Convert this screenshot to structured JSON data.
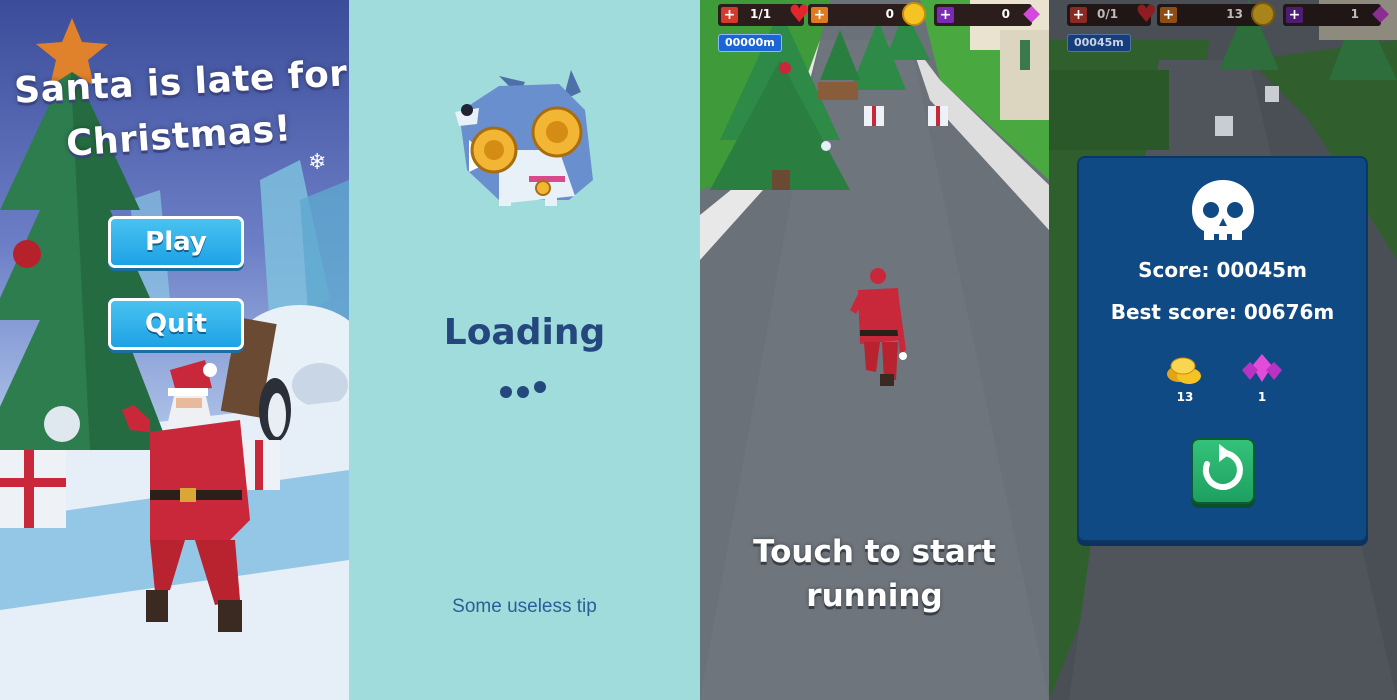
{
  "menu": {
    "title_line1": "Santa is late for",
    "title_line2": "Christmas!",
    "play_label": "Play",
    "quit_label": "Quit"
  },
  "loading": {
    "title": "Loading",
    "tip": "Some useless tip"
  },
  "run_screen": {
    "lives": "1/1",
    "coins": "0",
    "gems": "0",
    "distance": "00000m",
    "prompt_line1": "Touch to start",
    "prompt_line2": "running"
  },
  "game_over": {
    "lives": "0/1",
    "coins": "13",
    "gems": "1",
    "distance": "00045m",
    "score": "Score: 00045m",
    "best_score": "Best score: 00676m",
    "coins_count": "13",
    "gems_count": "1"
  },
  "icons": {
    "lives": "heart-icon",
    "coins": "coin-icon",
    "gems": "gem-icon",
    "game_over": "skull-icon",
    "restart": "restart-icon",
    "loading_logo": "wolf-logo-icon"
  },
  "colors": {
    "button_blue": "#1ea2e6",
    "loading_bg": "#a1dcdc",
    "loading_text": "#24477e",
    "card_blue": "#0f4a84",
    "restart_green": "#1ea060",
    "hud_lives": "#d33a2c",
    "hud_coins": "#e07a1e",
    "hud_gems": "#7a2bb5"
  }
}
